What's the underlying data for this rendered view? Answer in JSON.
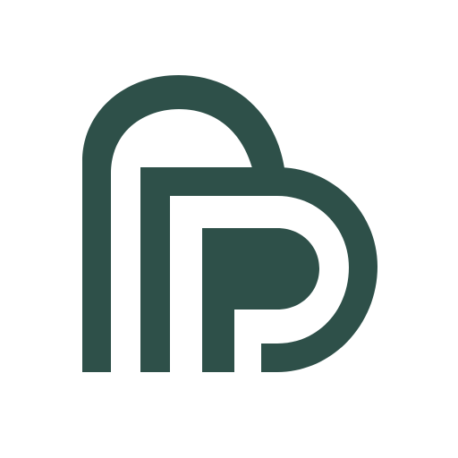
{
  "logo": {
    "icon": "stylized-p-heart-mark",
    "color": "#2e5049",
    "background": "#ffffff"
  }
}
